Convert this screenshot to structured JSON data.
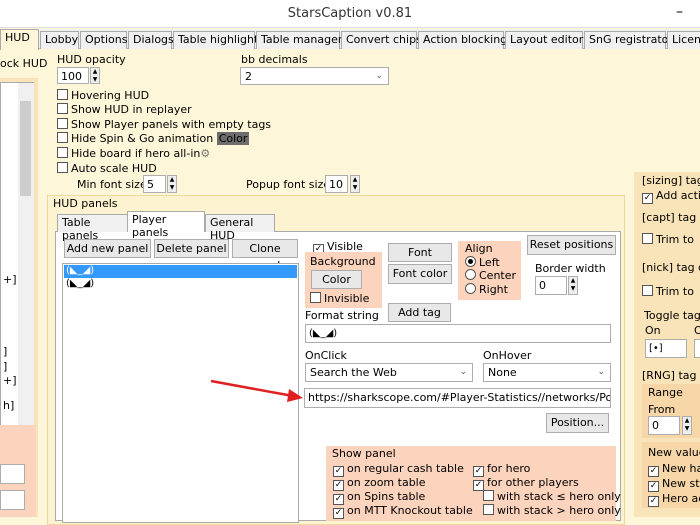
{
  "window": {
    "title": "StarsCaption v0.81",
    "minimize": "–"
  },
  "tabs": [
    "HUD",
    "Lobby",
    "Options",
    "Dialogs",
    "Table highlight",
    "Table manager",
    "Convert chips",
    "Action blocking",
    "Layout editor",
    "SnG registrator",
    "Licens"
  ],
  "left": {
    "label": "ock HUD",
    "list_fragments": [
      "+]",
      "]",
      "]",
      "+]",
      "h]"
    ]
  },
  "hud": {
    "opacity_label": "HUD opacity",
    "opacity": "100",
    "bb_label": "bb decimals",
    "bb_value": "2",
    "checks": [
      {
        "label": "Hovering HUD",
        "checked": false
      },
      {
        "label": "Show HUD in replayer",
        "checked": false
      },
      {
        "label": "Show Player panels with empty tags",
        "checked": false
      },
      {
        "label": "Hide Spin & Go animation",
        "checked": false
      },
      {
        "label": "Hide board if hero all-in",
        "checked": false
      },
      {
        "label": "Auto scale HUD",
        "checked": false
      }
    ],
    "color_label": "Color",
    "min_font_label": "Min font size",
    "min_font": "5",
    "popup_font_label": "Popup font size",
    "popup_font": "10"
  },
  "panels": {
    "group_label": "HUD panels",
    "subtabs": [
      "Table panels",
      "Player panels",
      "General HUD"
    ],
    "add": "Add new panel",
    "delete": "Delete panel",
    "clone": "Clone panel",
    "list": [
      "(◣_◢)",
      "(◣_◢)"
    ],
    "visible": "Visible",
    "background": "Background",
    "color": "Color",
    "invisible": "Invisible",
    "font": "Font",
    "font_color": "Font color",
    "add_tag": "Add tag",
    "align": "Align",
    "align_opts": [
      "Left",
      "Center",
      "Right"
    ],
    "reset": "Reset positions",
    "border_label": "Border width",
    "border": "0",
    "format_label": "Format string",
    "format": "(◣_◢)",
    "onclick_label": "OnClick",
    "onclick": "Search the Web",
    "onhover_label": "OnHover",
    "onhover": "None",
    "url": "https://sharkscope.com/#Player-Statistics//networks/PokerS",
    "position": "Position...",
    "show_label": "Show panel",
    "show_left": [
      "on regular cash table",
      "on zoom table",
      "on Spins table",
      "on MTT Knockout table"
    ],
    "show_right": [
      {
        "label": "for hero",
        "checked": true
      },
      {
        "label": "for other players",
        "checked": true
      },
      {
        "label": "with stack ≤ hero only",
        "checked": false
      },
      {
        "label": "with stack > hero only",
        "checked": false
      }
    ]
  },
  "right": {
    "sizing": "[sizing] tag",
    "add_action": "Add actio",
    "capt": "[capt] tag c",
    "trim1": "Trim to",
    "nick": "[nick] tag c",
    "trim2": "Trim to",
    "toggle": "Toggle tags",
    "on": "On",
    "off": "O",
    "on_val": "[•]",
    "rng": "[RNG] tag c",
    "range": "Range",
    "from": "From",
    "from_val": "0",
    "new_value": "New value",
    "nv": [
      "New ha",
      "New str",
      "Hero ac"
    ]
  },
  "colors": {
    "accent": "#3399ff",
    "arrow": "#e02020"
  }
}
